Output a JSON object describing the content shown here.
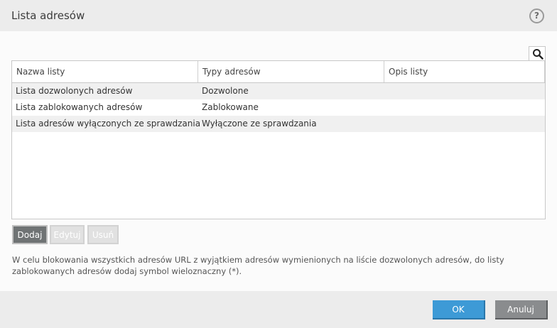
{
  "window": {
    "title": "Lista adresów",
    "help_label": "?"
  },
  "table": {
    "columns": [
      "Nazwa listy",
      "Typy adresów",
      "Opis listy"
    ],
    "rows": [
      {
        "name": "Lista dozwolonych adresów",
        "type": "Dozwolone",
        "description": ""
      },
      {
        "name": "Lista zablokowanych adresów",
        "type": "Zablokowane",
        "description": ""
      },
      {
        "name": "Lista adresów wyłączonych ze sprawdzania",
        "type": "Wyłączone ze sprawdzania",
        "description": ""
      }
    ]
  },
  "actions": {
    "add_label": "Dodaj",
    "edit_label": "Edytuj",
    "remove_label": "Usuń"
  },
  "note": "W celu blokowania wszystkich adresów URL z wyjątkiem adresów wymienionych na liście dozwolonych adresów, do listy zablokowanych adresów dodaj symbol wieloznaczny (*).",
  "footer": {
    "ok_label": "OK",
    "cancel_label": "Anuluj"
  },
  "icons": {
    "search": "search-icon",
    "help": "help-icon"
  },
  "colors": {
    "ok": "#3d9ad6",
    "cancel": "#8a8c8e",
    "add": "#6f7374"
  }
}
